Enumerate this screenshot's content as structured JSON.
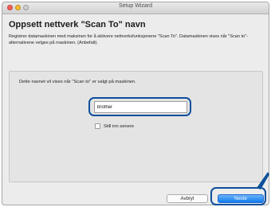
{
  "window": {
    "title": "Setup Wizard"
  },
  "page": {
    "heading": "Oppsett nettverk \"Scan To\" navn",
    "description": "Registrer datamaskinen med maksinen for å aktivere nettverksfunksjonene \"Scan To\". Datamaskinen vises når \"Scan to\"-alternativene velges på maskinen. (Anbefalt)."
  },
  "panel": {
    "label": "Dette navnet vil vises når \"Scan to\" er valgt på maskinen.",
    "name_field": {
      "value": "brother",
      "placeholder": ""
    },
    "checkbox": {
      "label": "Still inn senere",
      "checked": false
    }
  },
  "buttons": {
    "cancel": "Avbryt",
    "next": "Neste"
  },
  "colors": {
    "highlight_ring": "#0d4f9a",
    "primary_button": "#0d7bf0"
  },
  "icons": {
    "pointer": "pointer-arrow-icon"
  }
}
